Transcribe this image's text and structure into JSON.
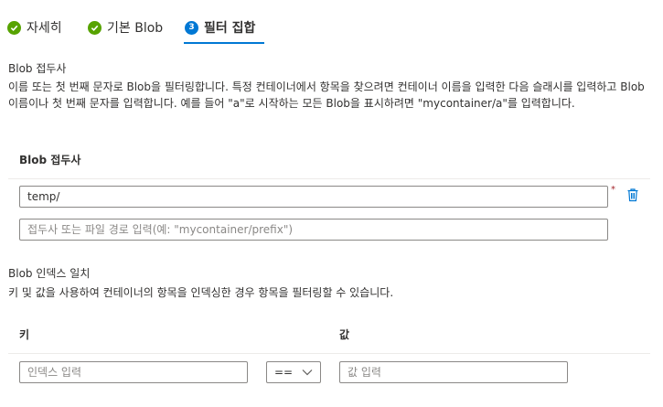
{
  "tabs": [
    {
      "label": "자세히",
      "status": "done"
    },
    {
      "label": "기본 Blob",
      "status": "done"
    },
    {
      "label": "필터 집합",
      "status": "active",
      "step": "3"
    }
  ],
  "prefix_section": {
    "title": "Blob 접두사",
    "description": "이름 또는 첫 번째 문자로 Blob을 필터링합니다. 특정 컨테이너에서 항목을 찾으려면 컨테이너 이름을 입력한 다음 슬래시를 입력하고 Blob 이름이나 첫 번째 문자를 입력합니다. 예를 들어 \"a\"로 시작하는 모든 Blob을 표시하려면 \"mycontainer/a\"를 입력합니다.",
    "column_header": "Blob 접두사",
    "row_value": "temp/",
    "required_mark": "*",
    "new_placeholder": "접두사 또는 파일 경로 입력(예: \"mycontainer/prefix\")"
  },
  "index_section": {
    "title": "Blob 인덱스 일치",
    "description": "키 및 값을 사용하여 컨테이너의 항목을 인덱싱한 경우 항목을 필터링할 수 있습니다.",
    "key_header": "키",
    "value_header": "값",
    "key_placeholder": "인덱스 입력",
    "operator": "==",
    "value_placeholder": "값 입력"
  },
  "colors": {
    "accent": "#0078d4",
    "success": "#57a300",
    "required": "#a4262c"
  }
}
